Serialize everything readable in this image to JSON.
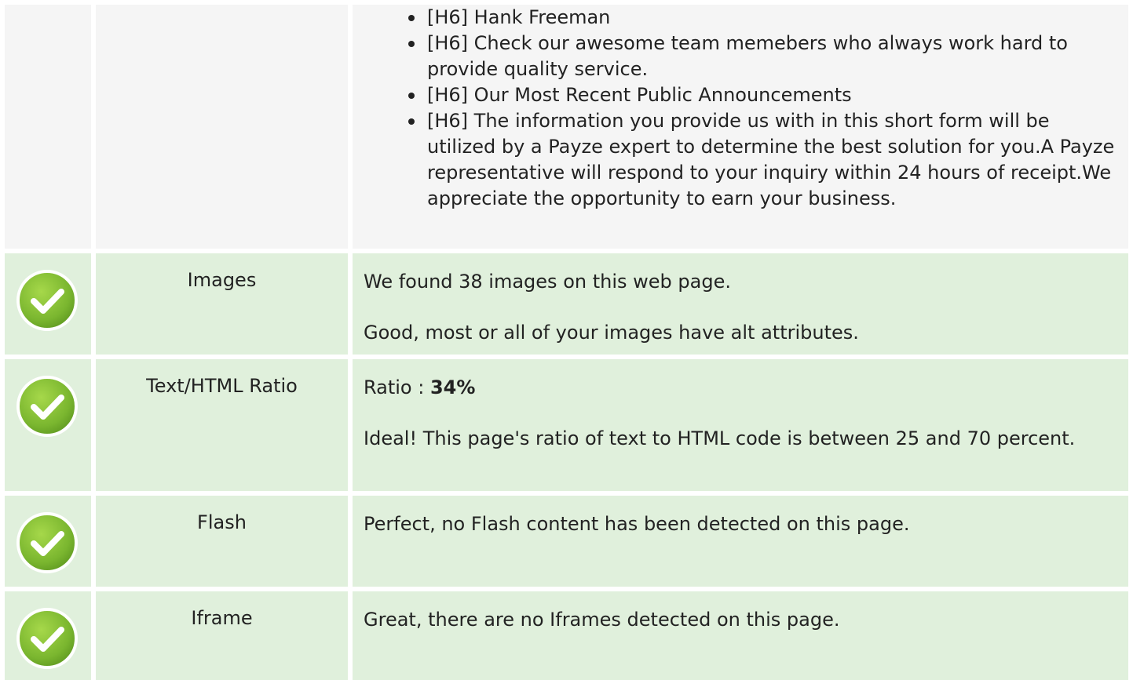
{
  "top_section": {
    "heading_items": [
      "[H6] Hank Freeman",
      "[H6] Check our awesome team memebers who always work hard to provide quality service.",
      "[H6] Our Most Recent Public Announcements",
      "[H6] The information you provide us with in this short form will be utilized by a Payze expert to determine the best solution for you.A Payze representative will respond to your inquiry within 24 hours of receipt.We appreciate the opportunity to earn your business."
    ]
  },
  "rows": {
    "images": {
      "status_icon": "check-circle-icon",
      "label": "Images",
      "line1": "We found 38 images on this web page.",
      "line2": "Good, most or all of your images have alt attributes."
    },
    "text_html_ratio": {
      "status_icon": "check-circle-icon",
      "label": "Text/HTML Ratio",
      "ratio_prefix": "Ratio : ",
      "ratio_value": "34%",
      "line2": "Ideal! This page's ratio of text to HTML code is between 25 and 70 percent."
    },
    "flash": {
      "status_icon": "check-circle-icon",
      "label": "Flash",
      "line1": "Perfect, no Flash content has been detected on this page."
    },
    "iframe": {
      "status_icon": "check-circle-icon",
      "label": "Iframe",
      "line1": "Great, there are no Iframes detected on this page."
    }
  },
  "colors": {
    "pass_row_background": "#e0f0dc",
    "neutral_row_background": "#f5f5f5",
    "check_green": "#7ab62f",
    "text": "#222222"
  }
}
